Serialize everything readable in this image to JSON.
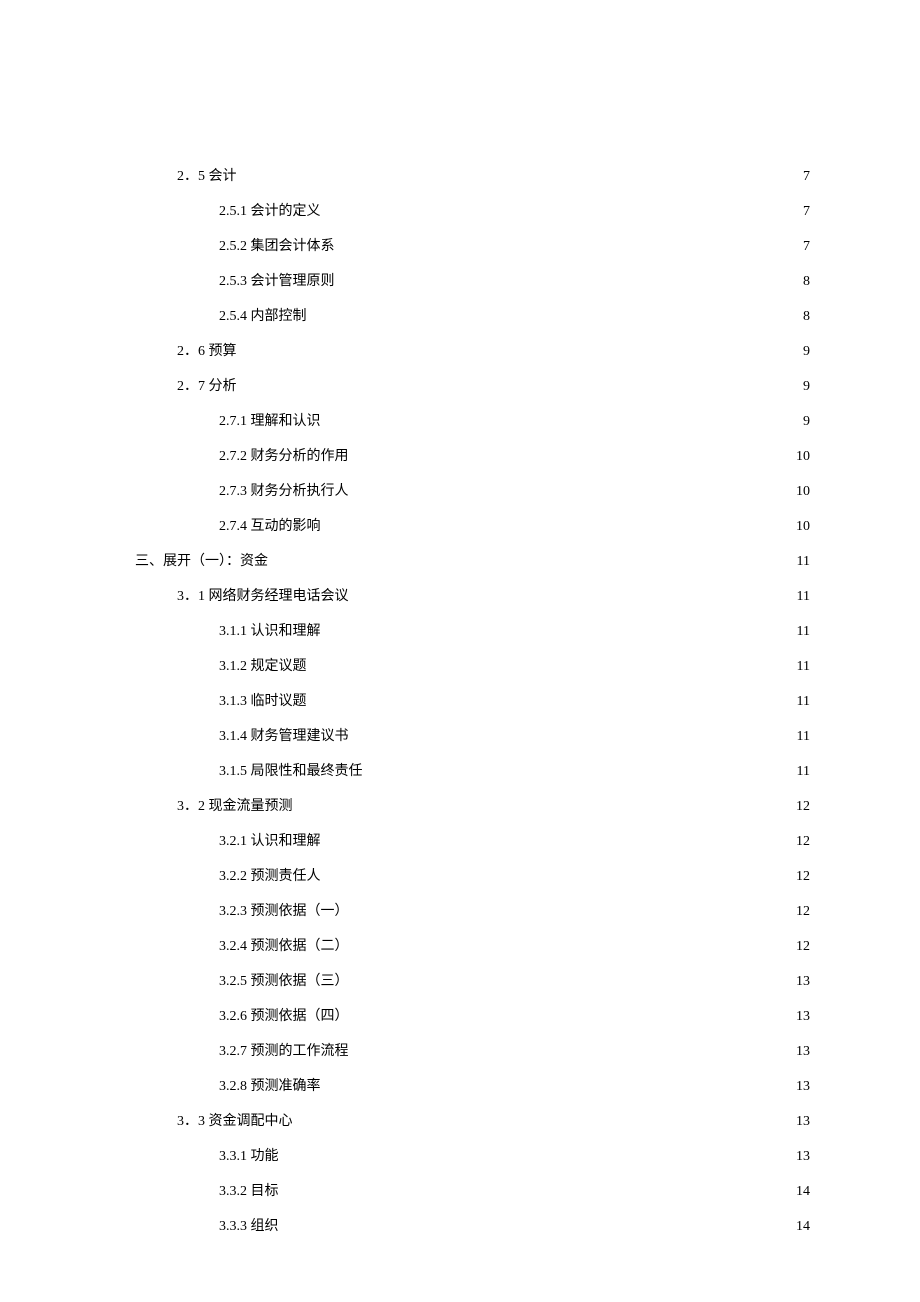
{
  "toc": [
    {
      "level": 1,
      "label": "2．5 会计",
      "page": "7"
    },
    {
      "level": 2,
      "label": "2.5.1 会计的定义",
      "page": "7"
    },
    {
      "level": 2,
      "label": "2.5.2 集团会计体系",
      "page": "7"
    },
    {
      "level": 2,
      "label": "2.5.3 会计管理原则",
      "page": "8"
    },
    {
      "level": 2,
      "label": "2.5.4 内部控制",
      "page": "8"
    },
    {
      "level": 1,
      "label": "2．6 预算",
      "page": "9"
    },
    {
      "level": 1,
      "label": "2．7 分析",
      "page": "9"
    },
    {
      "level": 2,
      "label": "2.7.1 理解和认识",
      "page": "9"
    },
    {
      "level": 2,
      "label": "2.7.2 财务分析的作用",
      "page": "10"
    },
    {
      "level": 2,
      "label": "2.7.3 财务分析执行人",
      "page": "10"
    },
    {
      "level": 2,
      "label": "2.7.4 互动的影响",
      "page": "10"
    },
    {
      "level": 0,
      "label": "三、展开（一）：资金",
      "page": "11"
    },
    {
      "level": 1,
      "label": "3．1 网络财务经理电话会议",
      "page": "11"
    },
    {
      "level": 2,
      "label": "3.1.1 认识和理解",
      "page": "11"
    },
    {
      "level": 2,
      "label": "3.1.2 规定议题",
      "page": "11"
    },
    {
      "level": 2,
      "label": "3.1.3 临时议题",
      "page": "11"
    },
    {
      "level": 2,
      "label": "3.1.4 财务管理建议书",
      "page": "11"
    },
    {
      "level": 2,
      "label": "3.1.5 局限性和最终责任",
      "page": "11"
    },
    {
      "level": 1,
      "label": "3．2 现金流量预测",
      "page": "12"
    },
    {
      "level": 2,
      "label": "3.2.1 认识和理解",
      "page": "12"
    },
    {
      "level": 2,
      "label": "3.2.2 预测责任人",
      "page": "12"
    },
    {
      "level": 2,
      "label": "3.2.3 预测依据（一）",
      "page": "12"
    },
    {
      "level": 2,
      "label": "3.2.4 预测依据（二）",
      "page": "12"
    },
    {
      "level": 2,
      "label": "3.2.5 预测依据（三）",
      "page": "13"
    },
    {
      "level": 2,
      "label": "3.2.6 预测依据（四）",
      "page": "13"
    },
    {
      "level": 2,
      "label": "3.2.7 预测的工作流程",
      "page": "13"
    },
    {
      "level": 2,
      "label": "3.2.8 预测准确率",
      "page": "13"
    },
    {
      "level": 1,
      "label": "3．3 资金调配中心",
      "page": "13"
    },
    {
      "level": 2,
      "label": "3.3.1 功能",
      "page": "13"
    },
    {
      "level": 2,
      "label": "3.3.2 目标",
      "page": "14"
    },
    {
      "level": 2,
      "label": "3.3.3 组织",
      "page": "14"
    }
  ]
}
